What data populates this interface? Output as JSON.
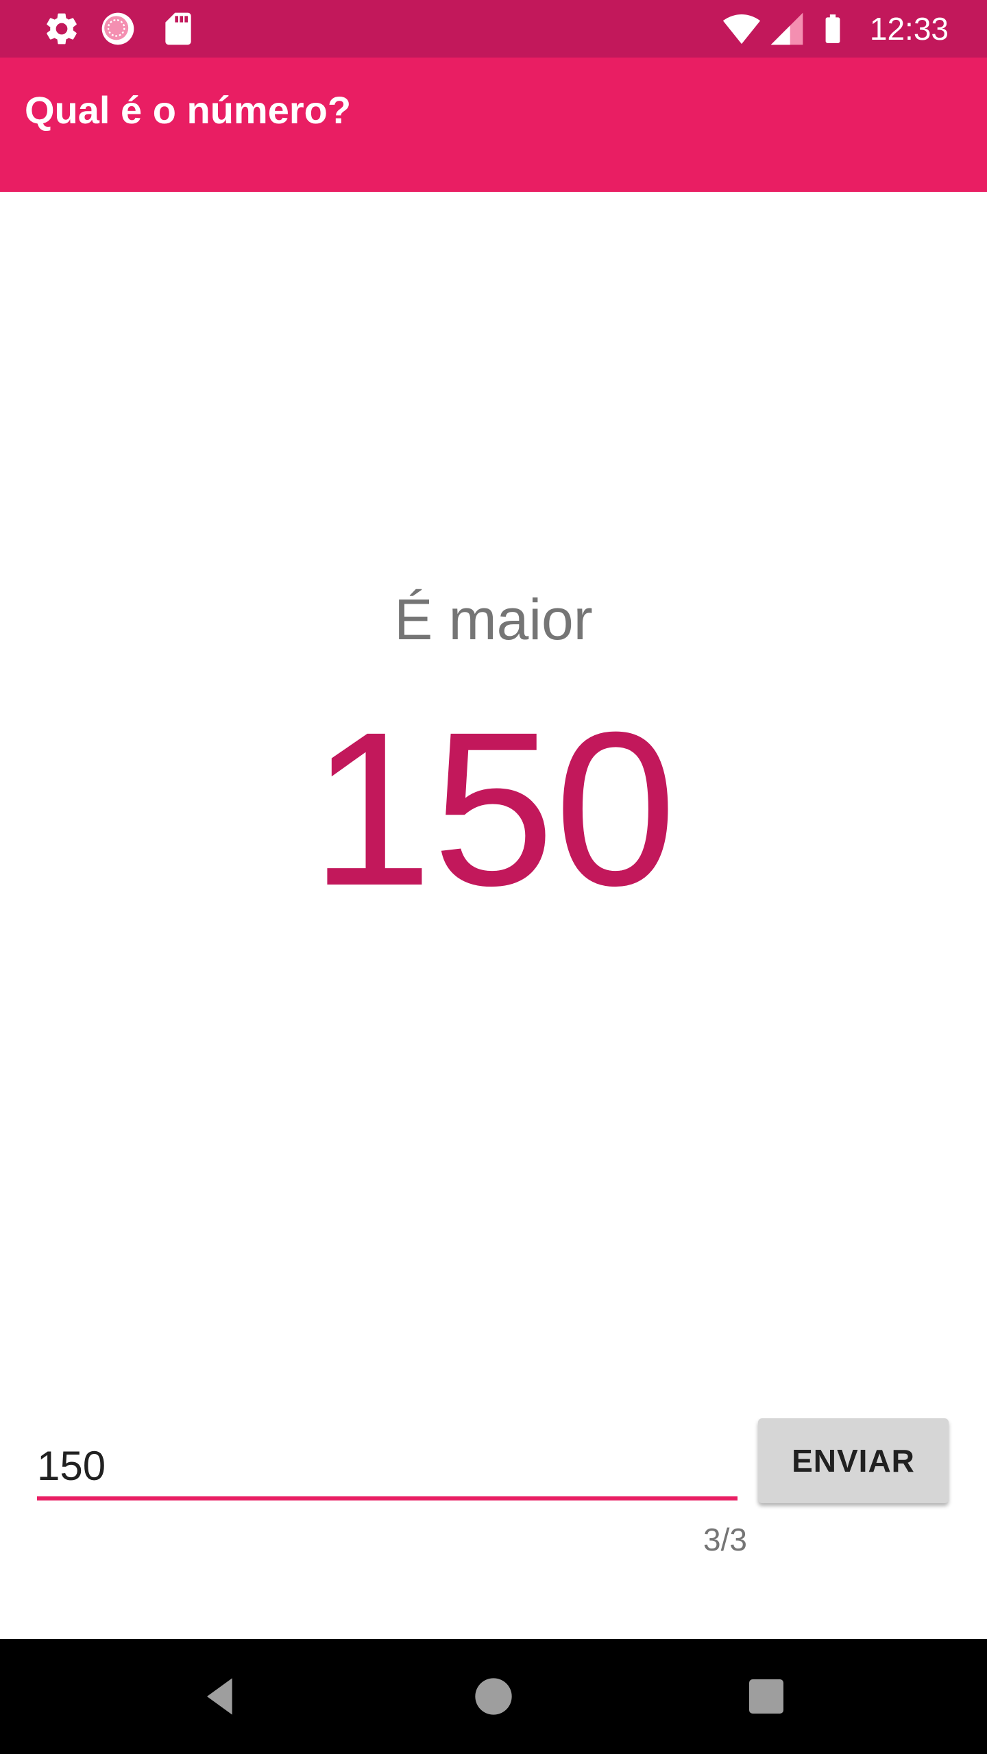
{
  "status_bar": {
    "time": "12:33",
    "left_icons": [
      "gear-icon",
      "sync-icon",
      "sd-card-icon"
    ],
    "right_icons": [
      "wifi-icon",
      "cell-signal-icon",
      "battery-icon"
    ]
  },
  "app_bar": {
    "title": "Qual é o número?"
  },
  "main": {
    "hint": "É maior",
    "guess": "150"
  },
  "input": {
    "value": "150",
    "counter": "3/3"
  },
  "actions": {
    "send_label": "ENVIAR"
  },
  "colors": {
    "status_bar": "#c2185b",
    "app_bar": "#e91e63",
    "accent": "#e91e63",
    "number": "#c2185b",
    "hint": "#757575",
    "button": "#d6d6d6"
  },
  "nav_bar": {
    "buttons": [
      "back-icon",
      "home-icon",
      "recents-icon"
    ]
  }
}
